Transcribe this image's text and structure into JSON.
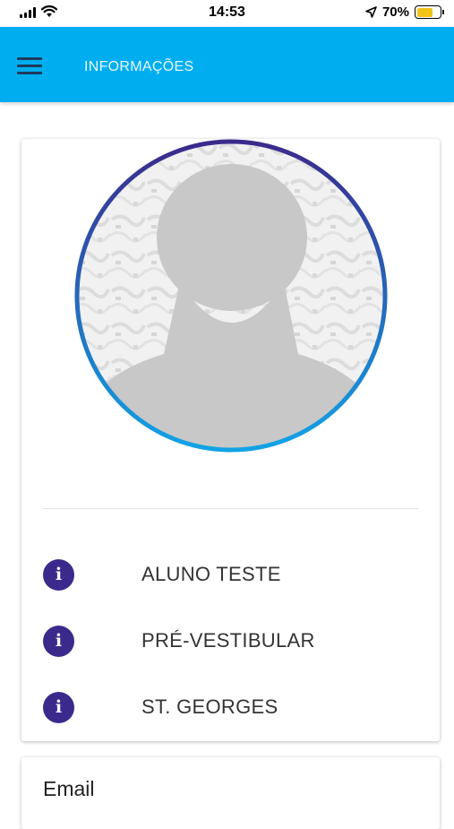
{
  "status_bar": {
    "time": "14:53",
    "battery_percent": "70%",
    "battery_level": 0.7,
    "battery_color": "#f2c318"
  },
  "app_bar": {
    "title": "INFORMAÇÕES",
    "menu_icon": "hamburger-menu-icon",
    "color": "#00aeef"
  },
  "profile": {
    "avatar_icon": "default-user-silhouette",
    "ring_gradient": [
      "#3b2a8c",
      "#12a3e6"
    ],
    "items": [
      {
        "icon": "info-icon",
        "label": "ALUNO TESTE"
      },
      {
        "icon": "info-icon",
        "label": "PRÉ-VESTIBULAR"
      },
      {
        "icon": "info-icon",
        "label": "ST. GEORGES"
      }
    ]
  },
  "email_card": {
    "heading": "Email"
  }
}
